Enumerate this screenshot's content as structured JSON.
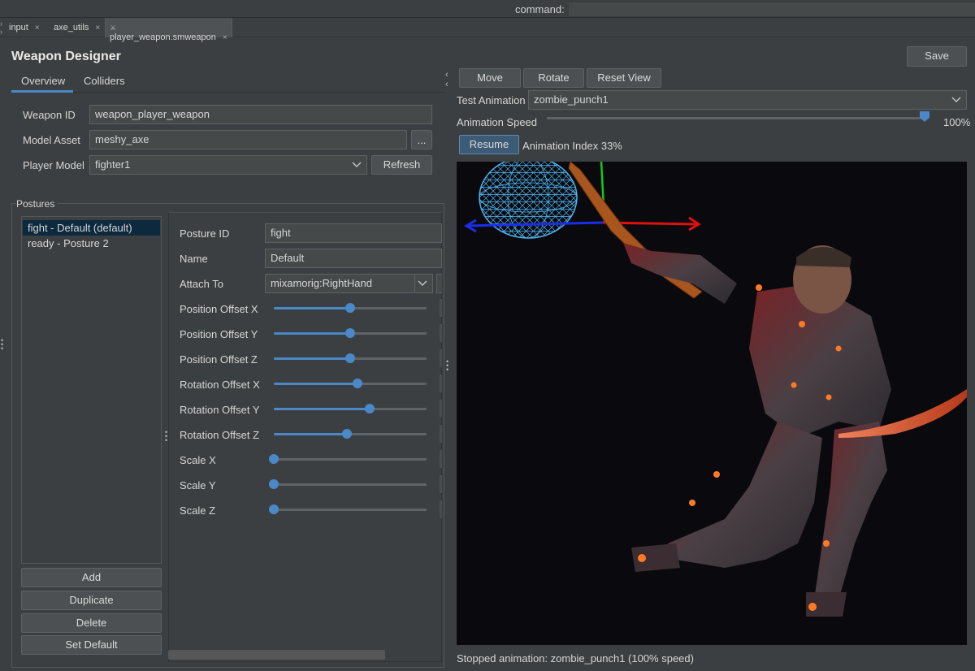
{
  "command_bar": {
    "label": "command:"
  },
  "tabs": [
    {
      "label": "input",
      "close": "×"
    },
    {
      "label": "axe_utils",
      "close": "×"
    },
    {
      "label": "player_weapon.smweapon",
      "close": "×",
      "icon": "sword-icon"
    }
  ],
  "title": "Weapon Designer",
  "save_label": "Save",
  "subtabs": [
    "Overview",
    "Colliders"
  ],
  "overview": {
    "weapon_id_label": "Weapon ID",
    "weapon_id_value": "weapon_player_weapon",
    "model_asset_label": "Model Asset",
    "model_asset_value": "meshy_axe",
    "browse_label": "...",
    "player_model_label": "Player Model",
    "player_model_value": "fighter1",
    "refresh_label": "Refresh"
  },
  "postures": {
    "title": "Postures",
    "items": [
      "fight - Default (default)",
      "ready - Posture 2"
    ],
    "buttons": [
      "Add",
      "Duplicate",
      "Delete",
      "Set Default"
    ]
  },
  "details": {
    "posture_id_label": "Posture ID",
    "posture_id_value": "fight",
    "name_label": "Name",
    "name_value": "Default",
    "attach_label": "Attach To",
    "attach_value": "mixamorig:RightHand",
    "sliders": [
      {
        "label": "Position Offset X",
        "fraction": 0.5
      },
      {
        "label": "Position Offset Y",
        "fraction": 0.5
      },
      {
        "label": "Position Offset Z",
        "fraction": 0.5
      },
      {
        "label": "Rotation Offset X",
        "fraction": 0.55
      },
      {
        "label": "Rotation Offset Y",
        "fraction": 0.63
      },
      {
        "label": "Rotation Offset Z",
        "fraction": 0.48
      },
      {
        "label": "Scale X",
        "fraction": 0.0
      },
      {
        "label": "Scale Y",
        "fraction": 0.0
      },
      {
        "label": "Scale Z",
        "fraction": 0.0
      }
    ]
  },
  "view_buttons": [
    "Move",
    "Rotate",
    "Reset View"
  ],
  "test_animation": {
    "label": "Test Animation",
    "value": "zombie_punch1"
  },
  "animation_speed": {
    "label": "Animation Speed",
    "value_text": "100%",
    "fraction": 1.0
  },
  "resume_label": "Resume",
  "animation_index_text": "Animation Index 33%",
  "status_text": "Stopped animation: zombie_punch1 (100% speed)",
  "colors": {
    "accent": "#4a88c7",
    "selection": "#0d293e",
    "gizmo_x": "#e01010",
    "gizmo_y": "#18c818",
    "gizmo_z": "#1a2ee8",
    "collider": "#4fb4f0"
  }
}
